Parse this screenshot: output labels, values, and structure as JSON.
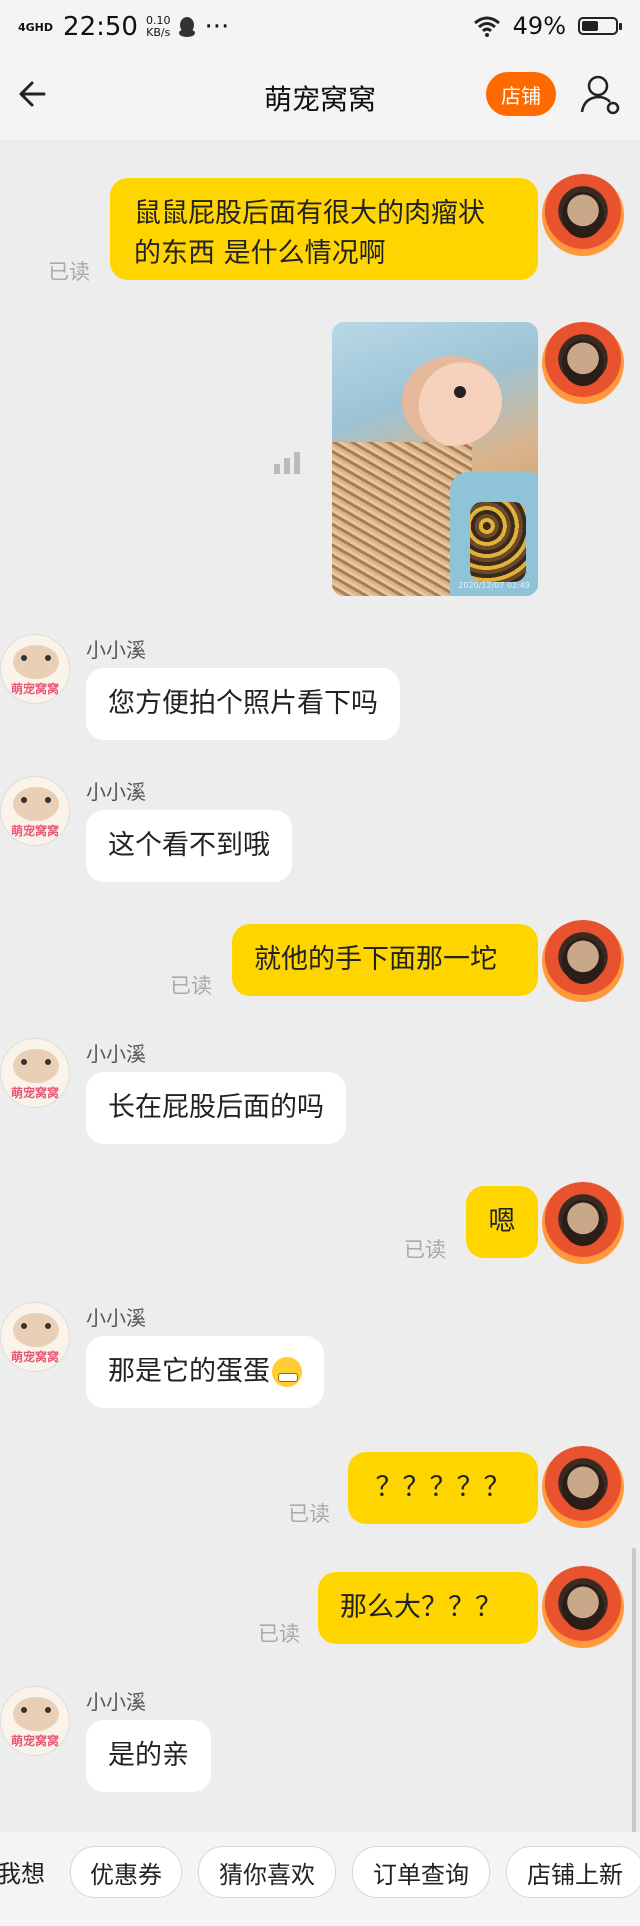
{
  "status_bar": {
    "network": "4GHD",
    "time": "22:50",
    "speed_value": "0.10",
    "speed_unit": "KB/s",
    "more": "···",
    "battery_percent": "49%",
    "battery_level": 0.49
  },
  "header": {
    "title": "萌宠窝窝",
    "shop_button": "店铺"
  },
  "messages": [
    {
      "from": "me",
      "type": "text",
      "text_line1": "鼠鼠屁股后面有很大的肉瘤状",
      "text_line2": "的东西 是什么情况啊",
      "read": "已读"
    },
    {
      "from": "me",
      "type": "image",
      "image_stamp": "2020/12/07 02:49"
    },
    {
      "from": "them",
      "name": "小小溪",
      "text": "您方便拍个照片看下吗"
    },
    {
      "from": "them",
      "name": "小小溪",
      "text": "这个看不到哦"
    },
    {
      "from": "me",
      "type": "text",
      "text": "就他的手下面那一坨",
      "read": "已读"
    },
    {
      "from": "them",
      "name": "小小溪",
      "text": "长在屁股后面的吗"
    },
    {
      "from": "me",
      "type": "text",
      "text": "嗯",
      "read": "已读"
    },
    {
      "from": "them",
      "name": "小小溪",
      "text": "那是它的蛋蛋"
    },
    {
      "from": "me",
      "type": "text",
      "text": "？？？？？",
      "read": "已读"
    },
    {
      "from": "me",
      "type": "text",
      "text": "那么大？？？",
      "read": "已读"
    },
    {
      "from": "them",
      "name": "小小溪",
      "text": "是的亲"
    }
  ],
  "avatar_logo_text": "萌宠窝窝",
  "quick_replies": [
    "我想",
    "优惠券",
    "猜你喜欢",
    "订单查询",
    "店铺上新"
  ],
  "colors": {
    "my_bubble": "#ffd500",
    "their_bubble": "#ffffff",
    "shop_button": "#ff6a00",
    "background": "#ededed"
  }
}
